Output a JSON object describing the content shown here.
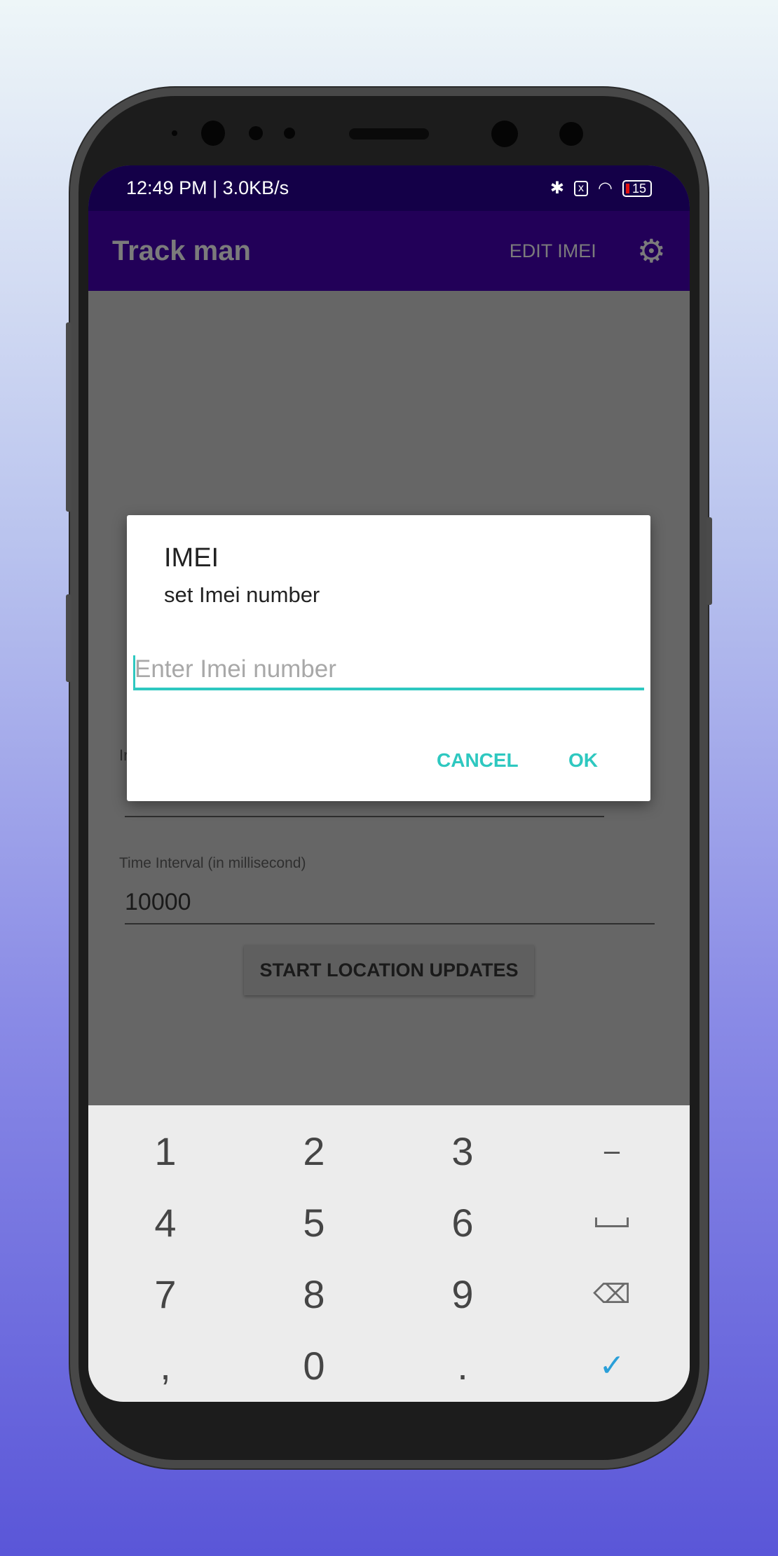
{
  "status_bar": {
    "time": "12:49 PM | 3.0KB/s",
    "battery": "15",
    "icons": [
      "bluetooth-icon",
      "sim-missing-icon",
      "wifi-icon",
      "battery-icon"
    ]
  },
  "app_bar": {
    "title": "Track man",
    "edit_imei": "EDIT IMEI",
    "settings_icon": "gear-icon",
    "background": "#220058"
  },
  "form": {
    "imei_label_fragment": "Ir",
    "interval_label": "Time Interval (in millisecond)",
    "interval_value": "10000",
    "start_button": "START LOCATION UPDATES"
  },
  "dialog": {
    "title": "IMEI",
    "message": "set Imei number",
    "input_placeholder": "Enter Imei number",
    "input_value": "",
    "cancel": "CANCEL",
    "ok": "OK",
    "accent": "#2ec8c0"
  },
  "keyboard": {
    "keys": [
      [
        "1",
        "2",
        "3",
        "–"
      ],
      [
        "4",
        "5",
        "6",
        "space"
      ],
      [
        "7",
        "8",
        "9",
        "backspace"
      ],
      [
        ",",
        "0",
        ".",
        "done"
      ]
    ],
    "done_color": "#2a9fd8"
  }
}
